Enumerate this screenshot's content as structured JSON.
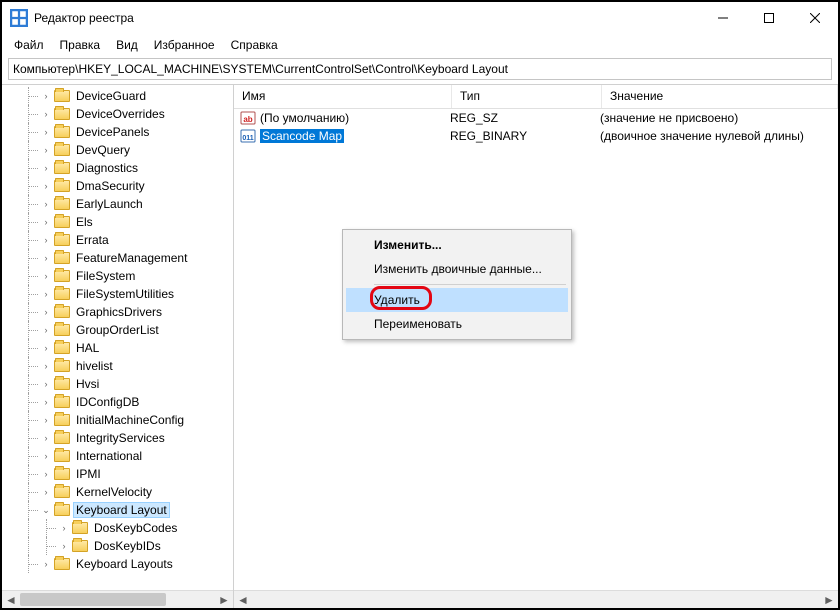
{
  "window": {
    "title": "Редактор реестра"
  },
  "menu": {
    "file": "Файл",
    "edit": "Правка",
    "view": "Вид",
    "favorites": "Избранное",
    "help": "Справка"
  },
  "path": "Компьютер\\HKEY_LOCAL_MACHINE\\SYSTEM\\CurrentControlSet\\Control\\Keyboard Layout",
  "columns": {
    "name": "Имя",
    "type": "Тип",
    "value": "Значение"
  },
  "tree": {
    "items": [
      {
        "label": "DeviceGuard",
        "level": 1
      },
      {
        "label": "DeviceOverrides",
        "level": 1
      },
      {
        "label": "DevicePanels",
        "level": 1
      },
      {
        "label": "DevQuery",
        "level": 1
      },
      {
        "label": "Diagnostics",
        "level": 1
      },
      {
        "label": "DmaSecurity",
        "level": 1
      },
      {
        "label": "EarlyLaunch",
        "level": 1
      },
      {
        "label": "Els",
        "level": 1
      },
      {
        "label": "Errata",
        "level": 1
      },
      {
        "label": "FeatureManagement",
        "level": 1
      },
      {
        "label": "FileSystem",
        "level": 1
      },
      {
        "label": "FileSystemUtilities",
        "level": 1
      },
      {
        "label": "GraphicsDrivers",
        "level": 1
      },
      {
        "label": "GroupOrderList",
        "level": 1
      },
      {
        "label": "HAL",
        "level": 1
      },
      {
        "label": "hivelist",
        "level": 1
      },
      {
        "label": "Hvsi",
        "level": 1
      },
      {
        "label": "IDConfigDB",
        "level": 1
      },
      {
        "label": "InitialMachineConfig",
        "level": 1
      },
      {
        "label": "IntegrityServices",
        "level": 1
      },
      {
        "label": "International",
        "level": 1
      },
      {
        "label": "IPMI",
        "level": 1
      },
      {
        "label": "KernelVelocity",
        "level": 1
      },
      {
        "label": "Keyboard Layout",
        "level": 1,
        "expanded": true,
        "selected": true
      },
      {
        "label": "DosKeybCodes",
        "level": 2
      },
      {
        "label": "DosKeybIDs",
        "level": 2
      },
      {
        "label": "Keyboard Layouts",
        "level": 1
      }
    ]
  },
  "values": {
    "rows": [
      {
        "name": "(По умолчанию)",
        "type": "REG_SZ",
        "value": "(значение не присвоено)",
        "icon": "str"
      },
      {
        "name": "Scancode Map",
        "type": "REG_BINARY",
        "value": "(двоичное значение нулевой длины)",
        "icon": "bin",
        "selected": true
      }
    ]
  },
  "context_menu": {
    "modify": "Изменить...",
    "modify_binary": "Изменить двоичные данные...",
    "delete": "Удалить",
    "rename": "Переименовать"
  }
}
